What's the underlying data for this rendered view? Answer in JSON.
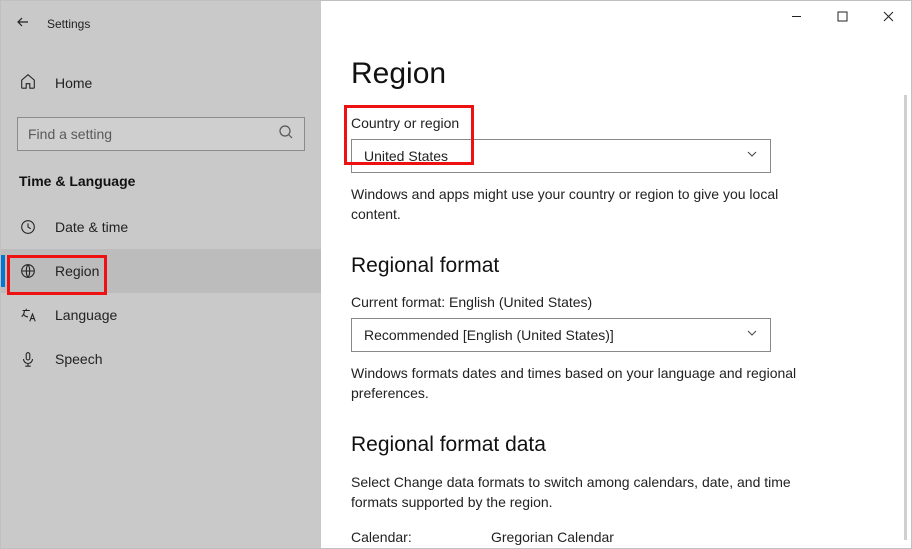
{
  "titlebar": {
    "label": "Settings"
  },
  "sidebar": {
    "home": "Home",
    "search_placeholder": "Find a setting",
    "section": "Time & Language",
    "items": [
      {
        "label": "Date & time"
      },
      {
        "label": "Region"
      },
      {
        "label": "Language"
      },
      {
        "label": "Speech"
      }
    ]
  },
  "main": {
    "heading": "Region",
    "country_label": "Country or region",
    "country_value": "United States",
    "country_desc": "Windows and apps might use your country or region to give you local content.",
    "format_heading": "Regional format",
    "current_format_label": "Current format: English (United States)",
    "format_value": "Recommended [English (United States)]",
    "format_desc": "Windows formats dates and times based on your language and regional preferences.",
    "data_heading": "Regional format data",
    "data_desc": "Select Change data formats to switch among calendars, date, and time formats supported by the region.",
    "calendar_label": "Calendar:",
    "calendar_value": "Gregorian Calendar"
  }
}
